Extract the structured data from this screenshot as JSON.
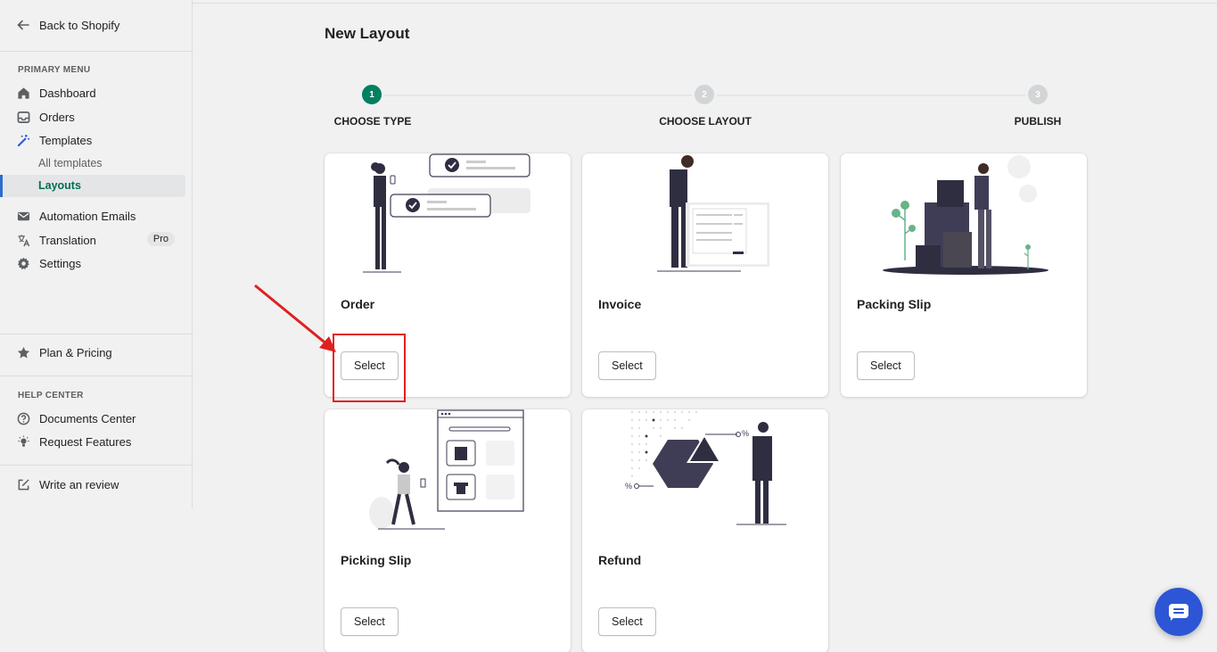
{
  "sidebar": {
    "back_label": "Back to Shopify",
    "primary_menu_title": "PRIMARY MENU",
    "items": [
      {
        "label": "Dashboard",
        "icon": "home-icon"
      },
      {
        "label": "Orders",
        "icon": "inbox-icon"
      },
      {
        "label": "Templates",
        "icon": "magic-wand-icon"
      },
      {
        "label": "Automation Emails",
        "icon": "envelope-icon"
      },
      {
        "label": "Translation",
        "icon": "translate-icon",
        "badge": "Pro"
      },
      {
        "label": "Settings",
        "icon": "gear-icon"
      }
    ],
    "sub_items": [
      {
        "label": "All templates"
      },
      {
        "label": "Layouts",
        "active": true
      }
    ],
    "plan_label": "Plan & Pricing",
    "help_center_title": "HELP CENTER",
    "help_items": [
      {
        "label": "Documents Center",
        "icon": "question-circle-icon"
      },
      {
        "label": "Request Features",
        "icon": "lightbulb-icon"
      }
    ],
    "review_label": "Write an review"
  },
  "main": {
    "title": "New Layout",
    "steps": [
      {
        "number": "1",
        "label": "CHOOSE TYPE",
        "active": true
      },
      {
        "number": "2",
        "label": "CHOOSE LAYOUT",
        "active": false
      },
      {
        "number": "3",
        "label": "PUBLISH",
        "active": false
      }
    ],
    "cards": [
      {
        "title": "Order",
        "button": "Select"
      },
      {
        "title": "Invoice",
        "button": "Select"
      },
      {
        "title": "Packing Slip",
        "button": "Select"
      },
      {
        "title": "Picking Slip",
        "button": "Select"
      },
      {
        "title": "Refund",
        "button": "Select"
      }
    ],
    "refund_labels": [
      "%",
      "%"
    ]
  },
  "colors": {
    "accent": "#008060",
    "active_nav": "#2c6ecb",
    "chat": "#2c56d6",
    "annotation": "#e02020"
  }
}
